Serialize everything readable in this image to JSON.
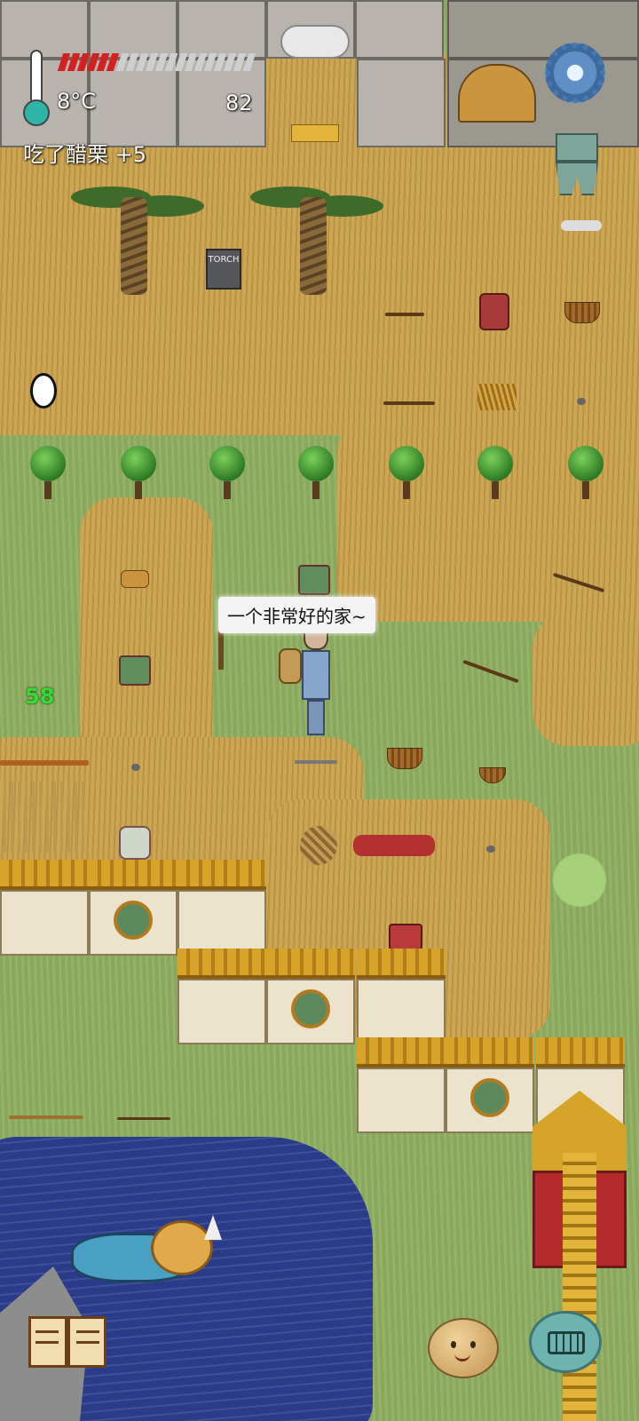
{
  "hud": {
    "temperature": "8°C",
    "yum_count": "82",
    "ate_message": "吃了醋栗 +5",
    "age": "58",
    "food_pips_filled": 6,
    "food_pips_total": 20
  },
  "speech": {
    "text": "一个非常好的家~"
  },
  "objects": {
    "torch_label": "TORCH"
  },
  "icons": {
    "settings": "gear-icon",
    "tech": "spade-coin-icon",
    "book": "book-icon",
    "emote": "face-icon",
    "keyboard": "keyboard-icon"
  },
  "colors": {
    "food_full": "#d32020",
    "food_empty": "#cfcfcf",
    "age_text": "#33dd33"
  }
}
